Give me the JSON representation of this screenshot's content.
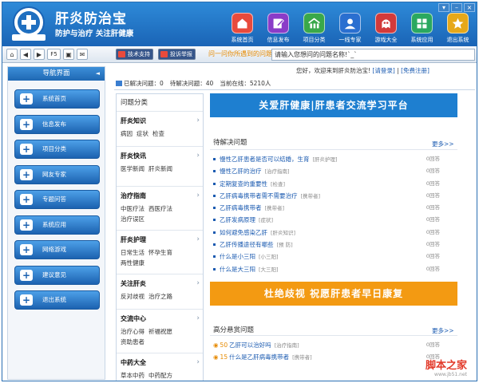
{
  "app": {
    "title": "肝炎防治宝",
    "subtitle": "防护与治疗 关注肝健康",
    "logo_text": "Liver Protection"
  },
  "window_controls": [
    "▾",
    "–",
    "×"
  ],
  "nav": [
    {
      "label": "系统首页",
      "icon": "home-icon",
      "color": "#e84a3c"
    },
    {
      "label": "信息发布",
      "icon": "edit-icon",
      "color": "#8a3cc8"
    },
    {
      "label": "项目分类",
      "icon": "category-icon",
      "color": "#3aa84a"
    },
    {
      "label": "一线专家",
      "icon": "expert-icon",
      "color": "#2a6fd0"
    },
    {
      "label": "游戏大全",
      "icon": "game-icon",
      "color": "#d23a3a"
    },
    {
      "label": "系统应用",
      "icon": "apps-icon",
      "color": "#2aa860"
    },
    {
      "label": "退出系统",
      "icon": "star-icon",
      "color": "#e6a81a"
    }
  ],
  "toolbar": {
    "buttons": [
      "⌂",
      "◀",
      "▶",
      "F5",
      "▣",
      "✉"
    ],
    "tag1": "技术支持",
    "tag2": "投诉举报",
    "ask_label": "问一问你所遇到的问题：",
    "ask_value": "请输入您想问的问题名称!`_`"
  },
  "sidebar": {
    "title": "导航界面",
    "collapse": "◄",
    "items": [
      "系统首页",
      "信息发布",
      "项目分类",
      "网友专家",
      "专题问答",
      "系统应用",
      "网络游戏",
      "建议意见",
      "退出系统"
    ]
  },
  "greeting": {
    "text": "您好，欢迎来到肝炎防治宝!",
    "login": "[请登录]",
    "register": "[免费注册]"
  },
  "stats": {
    "solved": "已解决问题：0",
    "pending": "待解决问题：40",
    "online": "当前在线：5210人"
  },
  "categories": {
    "title": "问题分类",
    "items": [
      {
        "name": "肝炎知识",
        "links": [
          "病因",
          "症状",
          "检查"
        ]
      },
      {
        "name": "肝炎快讯",
        "links": [
          "医学新闻",
          "肝炎新闻"
        ]
      },
      {
        "name": "治疗指南",
        "links": [
          "中医疗法",
          "西医疗法",
          "治疗误区"
        ]
      },
      {
        "name": "肝炎护理",
        "links": [
          "日常生活",
          "怀孕生育",
          "两性健康"
        ]
      },
      {
        "name": "关注肝炎",
        "links": [
          "反对歧视",
          "治疗之路"
        ]
      },
      {
        "name": "交流中心",
        "links": [
          "治疗心得",
          "祈福祝愿",
          "资助患者"
        ]
      },
      {
        "name": "中药大全",
        "links": [
          "草本中药",
          "中药配方"
        ]
      }
    ],
    "arrow": "›"
  },
  "banner1": "关爱肝健康|肝患者交流学习平台",
  "pending_section": {
    "title": "待解决问题",
    "more": "更多>>",
    "items": [
      {
        "title": "慢性乙肝患者是否可以结婚，生育",
        "tag": "[肝炎护理]",
        "ans": "0回答"
      },
      {
        "title": "慢性乙肝的治疗",
        "tag": "[治疗指南]",
        "ans": "0回答"
      },
      {
        "title": "定期复查的重要性",
        "tag": "[检查]",
        "ans": "0回答"
      },
      {
        "title": "乙肝病毒携带者需不需要治疗",
        "tag": "[携带者]",
        "ans": "0回答"
      },
      {
        "title": "乙肝病毒携带者",
        "tag": "[携带者]",
        "ans": "0回答"
      },
      {
        "title": "乙肝发病原理",
        "tag": "[症状]",
        "ans": "0回答"
      },
      {
        "title": "如何避免感染乙肝",
        "tag": "[肝炎知识]",
        "ans": "0回答"
      },
      {
        "title": "乙肝传播途径有哪些",
        "tag": "[预 防]",
        "ans": "0回答"
      },
      {
        "title": "什么是小三阳",
        "tag": "[小三阳]",
        "ans": "0回答"
      },
      {
        "title": "什么是大三阳",
        "tag": "[大三阳]",
        "ans": "0回答"
      }
    ]
  },
  "banner2": "杜绝歧视  祝愿肝患者早日康复",
  "reward_section": {
    "title": "高分悬赏问题",
    "more": "更多>>",
    "items": [
      {
        "coin": "50",
        "title": "乙肝可以治好吗",
        "tag": "[治疗指南]",
        "ans": "0回答"
      },
      {
        "coin": "15",
        "title": "什么是乙肝病毒携带者",
        "tag": "[携带者]",
        "ans": "0回答"
      }
    ]
  },
  "watermark": {
    "text": "脚本之家",
    "url": "www.jb51.net"
  },
  "colors": {
    "header": "#1f6fc0",
    "accent": "#f39a12",
    "banner": "#1e7fd0"
  }
}
